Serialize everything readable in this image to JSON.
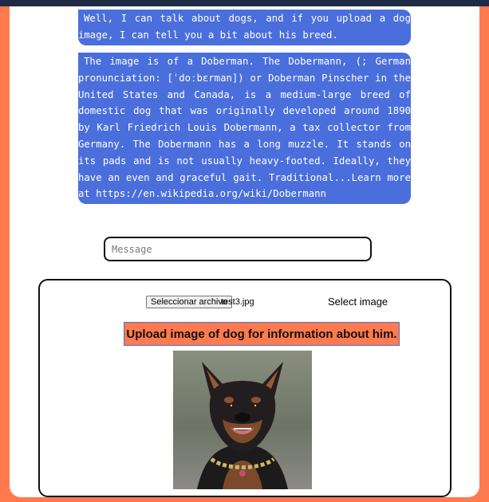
{
  "chat": {
    "bot_greeting": "Well, I can talk about dogs, and if you upload a dog image, I can tell you a bit about his breed.",
    "breed_info": "The image is of a Doberman. The Dobermann, (; German pronunciation: [ˈdoːbɛrman]) or Doberman Pinscher in the United States and Canada, is a medium-large breed of domestic dog that was originally developed around 1890 by Karl Friedrich Louis Dobermann, a tax collector from Germany. The Dobermann has a long muzzle. It stands on its pads and is not usually heavy-footed. Ideally, they have an even and graceful gait. Traditional...Learn more at https://en.wikipedia.org/wiki/Dobermann"
  },
  "message_input": {
    "placeholder": "Message",
    "value": ""
  },
  "upload": {
    "file_button_label": "Seleccionar archivo",
    "file_name": "test3.jpg",
    "select_label": "Select image",
    "submit_label": "Upload image of dog for information about him."
  },
  "colors": {
    "background": "#ff7a4d",
    "bubble": "#4a6fdc",
    "upload_button": "#ff7a4d",
    "top_bar": "#1f2a44"
  },
  "icons": {
    "preview": "dog-photo"
  }
}
